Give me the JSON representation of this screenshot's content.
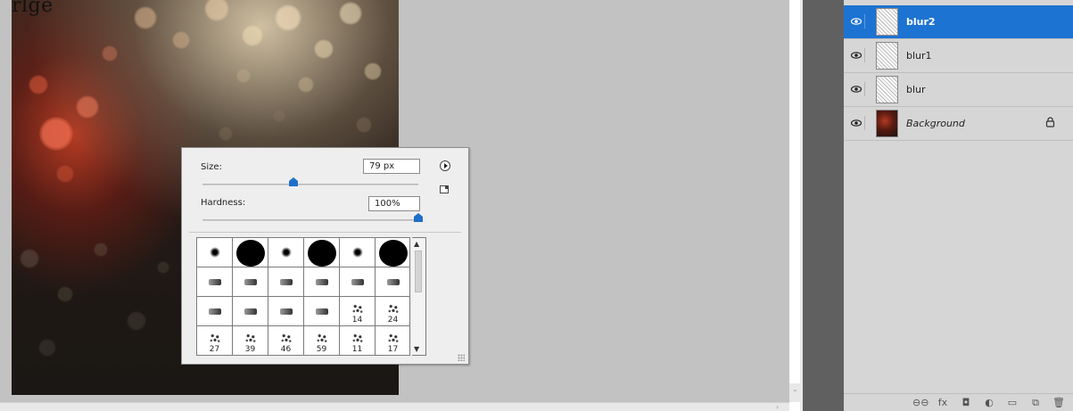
{
  "canvas": {
    "top_label": "rlge"
  },
  "brush_picker": {
    "size_label": "Size:",
    "size_value": "79 px",
    "size_slider_fraction": 0.42,
    "hardness_label": "Hardness:",
    "hardness_value": "100%",
    "hardness_slider_fraction": 1.0,
    "presets": [
      {
        "kind": "soft",
        "num": ""
      },
      {
        "kind": "hard",
        "num": ""
      },
      {
        "kind": "soft",
        "num": ""
      },
      {
        "kind": "hard",
        "num": ""
      },
      {
        "kind": "soft",
        "num": ""
      },
      {
        "kind": "hard",
        "num": ""
      },
      {
        "kind": "tip",
        "num": ""
      },
      {
        "kind": "tip",
        "num": ""
      },
      {
        "kind": "tip",
        "num": ""
      },
      {
        "kind": "tip",
        "num": ""
      },
      {
        "kind": "tip",
        "num": ""
      },
      {
        "kind": "tip",
        "num": ""
      },
      {
        "kind": "tip",
        "num": ""
      },
      {
        "kind": "tip",
        "num": ""
      },
      {
        "kind": "tip",
        "num": ""
      },
      {
        "kind": "tip",
        "num": ""
      },
      {
        "kind": "scatter",
        "num": "14"
      },
      {
        "kind": "scatter",
        "num": "24"
      },
      {
        "kind": "scatter",
        "num": "27"
      },
      {
        "kind": "scatter",
        "num": "39"
      },
      {
        "kind": "scatter",
        "num": "46"
      },
      {
        "kind": "scatter",
        "num": "59"
      },
      {
        "kind": "scatter",
        "num": "11"
      },
      {
        "kind": "scatter",
        "num": "17"
      }
    ]
  },
  "layers": [
    {
      "name": "blur2",
      "selected": true,
      "thumb": "pattern",
      "italic": false,
      "locked": false
    },
    {
      "name": "blur1",
      "selected": false,
      "thumb": "pattern",
      "italic": false,
      "locked": false
    },
    {
      "name": "blur",
      "selected": false,
      "thumb": "pattern",
      "italic": false,
      "locked": false
    },
    {
      "name": "Background",
      "selected": false,
      "thumb": "image",
      "italic": true,
      "locked": true
    }
  ],
  "footer_icons": [
    {
      "name": "link-layers-icon",
      "glyph": "⊖⊖"
    },
    {
      "name": "fx-icon",
      "glyph": "fx"
    },
    {
      "name": "layer-mask-icon",
      "glyph": "◘"
    },
    {
      "name": "adjustment-layer-icon",
      "glyph": "◐"
    },
    {
      "name": "group-folder-icon",
      "glyph": "▭"
    },
    {
      "name": "new-layer-icon",
      "glyph": "⧉"
    },
    {
      "name": "trash-icon",
      "glyph": "🗑"
    }
  ],
  "colors": {
    "selection": "#1d73d2",
    "slider_thumb": "#1f6fc9",
    "panel_bg": "#d6d6d6",
    "workspace_bg": "#c2c2c2"
  }
}
